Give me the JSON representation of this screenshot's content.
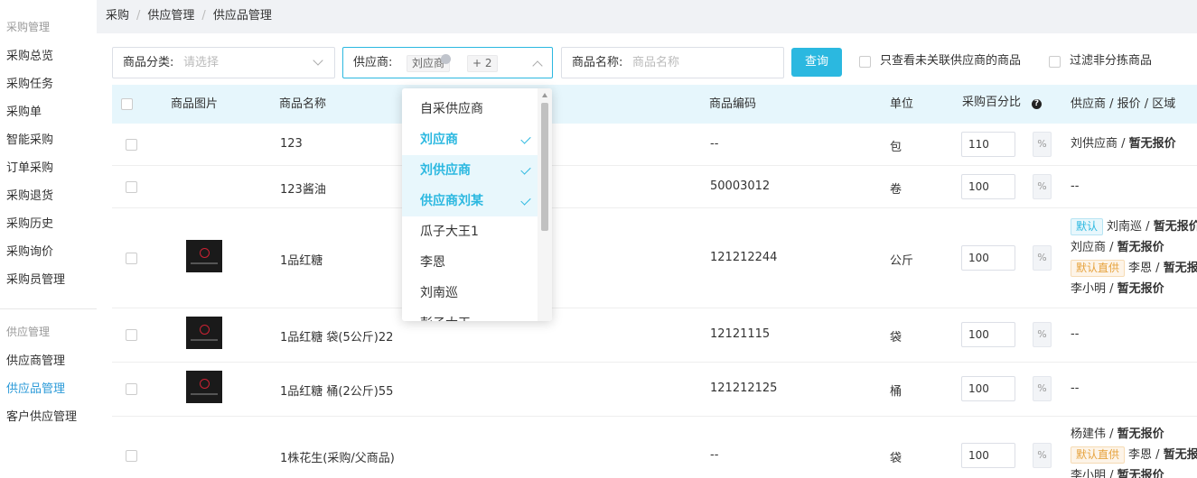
{
  "breadcrumb": [
    "采购",
    "供应管理",
    "供应品管理"
  ],
  "sidebar": {
    "group1_title": "采购管理",
    "group1_items": [
      "采购总览",
      "采购任务",
      "采购单",
      "智能采购",
      "订单采购",
      "采购退货",
      "采购历史",
      "采购询价",
      "采购员管理"
    ],
    "group2_title": "供应管理",
    "group2_items": [
      "供应商管理",
      "供应品管理",
      "客户供应管理"
    ],
    "active": "供应品管理"
  },
  "filters": {
    "category_label": "商品分类:",
    "category_placeholder": "请选择",
    "supplier_label": "供应商:",
    "supplier_tag": "刘应商",
    "supplier_more": "+ 2",
    "name_label": "商品名称:",
    "name_placeholder": "商品名称",
    "query_button": "查询",
    "check_unlinked": "只查看未关联供应商的商品",
    "check_nonsort": "过滤非分拣商品"
  },
  "table": {
    "headers": [
      "商品图片",
      "商品名称",
      "商品编码",
      "单位",
      "采购百分比",
      "供应商 / 报价 / 区域"
    ],
    "percent_unit": "%",
    "rows": [
      {
        "name": "123",
        "code": "--",
        "unit": "包",
        "percent": "110",
        "has_image": false,
        "suppliers": [
          {
            "badge": "",
            "name": "刘供应商",
            "quote": "暂无报价"
          }
        ]
      },
      {
        "name": "123酱油",
        "code": "50003012",
        "unit": "卷",
        "percent": "100",
        "has_image": false,
        "suppliers": [
          {
            "badge": "",
            "name": "--",
            "quote": ""
          }
        ]
      },
      {
        "name": "1品红糖",
        "code": "121212244",
        "unit": "公斤",
        "percent": "100",
        "has_image": true,
        "suppliers": [
          {
            "badge": "默认",
            "name": "刘南巡",
            "quote": "暂无报价"
          },
          {
            "badge": "",
            "name": "刘应商",
            "quote": "暂无报价"
          },
          {
            "badge": "默认直供",
            "name": "李恩",
            "quote": "暂无报价"
          },
          {
            "badge": "",
            "name": "李小明",
            "quote": "暂无报价"
          }
        ]
      },
      {
        "name": "1品红糖 袋(5公斤)22",
        "code": "12121115",
        "unit": "袋",
        "percent": "100",
        "has_image": true,
        "suppliers": [
          {
            "badge": "",
            "name": "--",
            "quote": ""
          }
        ]
      },
      {
        "name": "1品红糖 桶(2公斤)55",
        "code": "121212125",
        "unit": "桶",
        "percent": "100",
        "has_image": true,
        "suppliers": [
          {
            "badge": "",
            "name": "--",
            "quote": ""
          }
        ]
      },
      {
        "name": "1株花生(采购/父商品)",
        "code": "--",
        "unit": "袋",
        "percent": "100",
        "has_image": false,
        "suppliers": [
          {
            "badge": "",
            "name": "杨建伟",
            "quote": "暂无报价"
          },
          {
            "badge": "默认直供",
            "name": "李恩",
            "quote": "暂无报价"
          },
          {
            "badge": "",
            "name": "李小明",
            "quote": "暂无报价"
          }
        ]
      }
    ]
  },
  "supplier_dropdown": {
    "items": [
      {
        "label": "自采供应商",
        "selected": false
      },
      {
        "label": "刘应商",
        "selected": true
      },
      {
        "label": "刘供应商",
        "selected": true
      },
      {
        "label": "供应商刘某",
        "selected": true
      },
      {
        "label": "瓜子大王1",
        "selected": false
      },
      {
        "label": "李恩",
        "selected": false
      },
      {
        "label": "刘南巡",
        "selected": false
      },
      {
        "label": "彭子大王",
        "selected": false
      }
    ],
    "hover_index": 2
  },
  "colors": {
    "accent": "#2bb8e0",
    "header_bg": "#e6f6fc",
    "active_nav": "#2b9ad8"
  }
}
